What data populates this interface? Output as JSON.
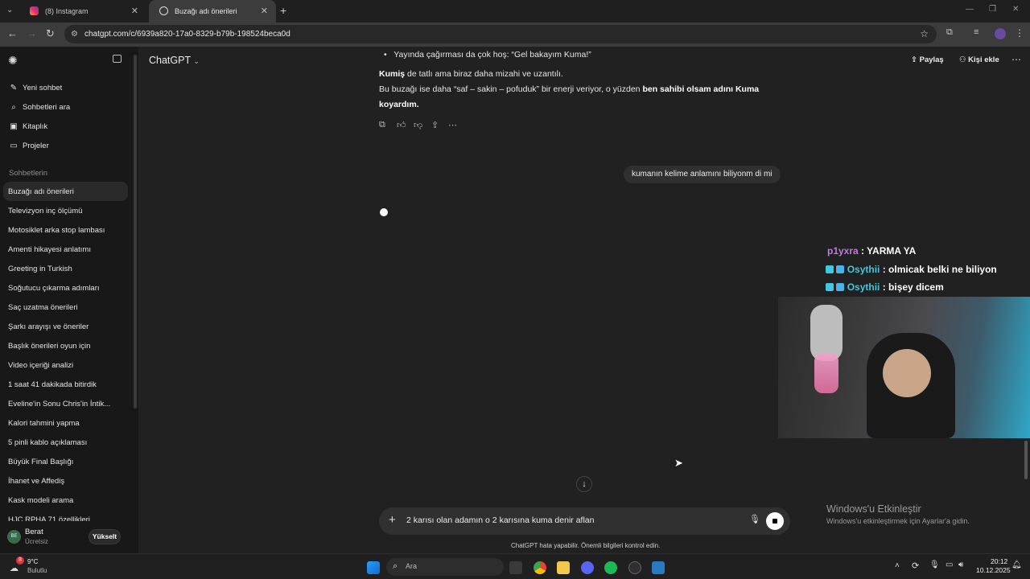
{
  "browser": {
    "tabs": [
      {
        "label": "(8) Instagram"
      },
      {
        "label": "Buzağı adı önerileri"
      }
    ],
    "url": "chatgpt.com/c/6939a820-17a0-8329-b79b-198524beca0d"
  },
  "sidebar": {
    "nav": [
      {
        "label": "Yeni sohbet",
        "icon": "pencil-icon"
      },
      {
        "label": "Sohbetleri ara",
        "icon": "search-icon"
      },
      {
        "label": "Kitaplık",
        "icon": "library-icon"
      },
      {
        "label": "Projeler",
        "icon": "folder-icon"
      }
    ],
    "heading": "Sohbetlerin",
    "chats": [
      "Buzağı adı önerileri",
      "Televizyon inç ölçümü",
      "Motosiklet arka stop lambası",
      "Amenti hikayesi anlatımı",
      "Greeting in Turkish",
      "Soğutucu çıkarma adımları",
      "Saç uzatma önerileri",
      "Şarkı arayışı ve öneriler",
      "Başlık önerileri oyun için",
      "Video içeriği analizi",
      "1 saat 41 dakikada bitirdik",
      "Eveline'in Sonu Chris'in İntik...",
      "Kalori tahmini yapma",
      "5 pinli kablo açıklaması",
      "Büyük Final Başlığı",
      "İhanet ve Affediş",
      "Kask modeli arama",
      "HJC RPHA 71 özellikleri"
    ],
    "user": {
      "name": "Berat",
      "plan": "Ücretsiz",
      "initials": "BE",
      "upgrade": "Yükselt"
    }
  },
  "header": {
    "model": "ChatGPT",
    "share": "Paylaş",
    "add_person": "Kişi ekle"
  },
  "conversation": {
    "bullet": "Yayında çağırması da çok hoş: “Gel bakayım Kuma!”",
    "p1_bold": "Kumiş",
    "p1_rest": " de tatlı ama biraz daha mizahi ve uzantılı.",
    "p2_start": "Bu buzağı ise daha “saf – sakin – pofuduk” bir enerji veriyor, o yüzden ",
    "p2_bold": "ben sahibi olsam adını Kuma koyardım.",
    "user_message": "kumanın kelime anlamını biliyonm di mi"
  },
  "composer": {
    "text": "2 karısı olan adamın o 2 karısına kuma denir aflan",
    "disclaimer": "ChatGPT hata yapabilir. Önemli bilgileri kontrol edin."
  },
  "stream_chat": [
    {
      "user": "p1yxra",
      "sep": " : ",
      "msg": "YARMA YA",
      "color": "#c27ae0"
    },
    {
      "user": "Osythii",
      "sep": " : ",
      "msg": "olmicak belki ne biliyon",
      "color": "#3ec9e0"
    },
    {
      "user": "Osythii",
      "sep": " : ",
      "msg": "bişey dicem",
      "color": "#3ec9e0"
    }
  ],
  "watermark": {
    "title": "Windows'u Etkinleştir",
    "subtitle": "Windows'u etkinleştirmek için Ayarlar'a gidin."
  },
  "taskbar": {
    "weather_temp": "9°C",
    "weather_desc": "Bulutlu",
    "weather_badge": "8",
    "search": "Ara",
    "time": "20:12",
    "date": "10.12.2025"
  },
  "colors": {
    "bg": "#212121",
    "sidebar": "#181818",
    "bubble": "#303030"
  }
}
